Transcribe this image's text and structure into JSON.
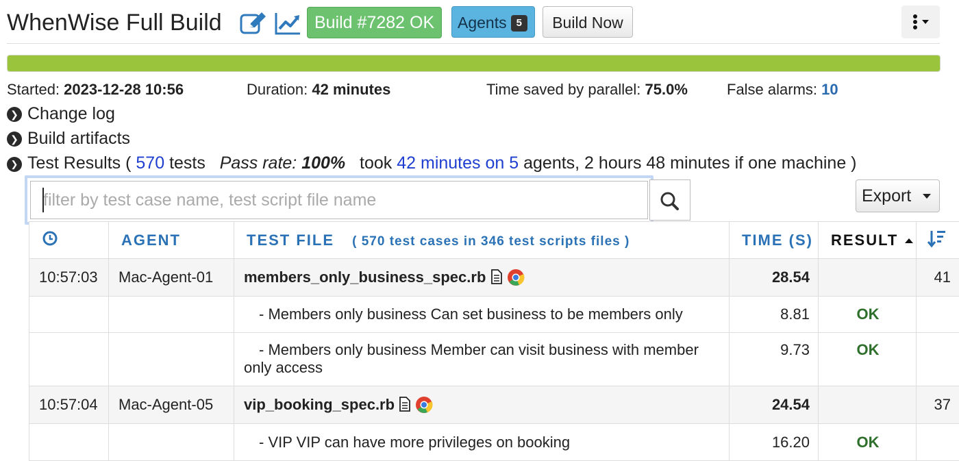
{
  "header": {
    "title": "WhenWise Full Build",
    "build_badge": "Build #7282 OK",
    "agents_label": "Agents",
    "agents_count": "5",
    "build_now": "Build Now",
    "menu_icon": "vertical-ellipsis-dropdown-icon"
  },
  "progress": {
    "fraction": 1.0,
    "color": "#9ac43b"
  },
  "stats": {
    "started_label": "Started:",
    "started_value": "2023-12-28 10:56",
    "duration_label": "Duration:",
    "duration_value": "42 minutes",
    "saved_label": "Time saved by parallel:",
    "saved_value": "75.0%",
    "false_alarms_label": "False alarms:",
    "false_alarms_value": "10"
  },
  "sections": {
    "change_log": "Change log",
    "build_artifacts": "Build artifacts",
    "test_results": {
      "label": "Test Results (",
      "tests_count": "570",
      "tests_word": "tests",
      "pass_label": "Pass rate:",
      "pass_value": "100%",
      "took": "took",
      "duration": "42 minutes",
      "on": "on",
      "agents": "5",
      "agents_tail": "agents, 2 hours 48 minutes if one machine )"
    }
  },
  "filter": {
    "placeholder": "filter by test case name, test script file name"
  },
  "export_label": "Export",
  "table": {
    "headers": {
      "agent": "AGENT",
      "test_file": "TEST FILE",
      "test_file_info": "( 570 test cases in 346 test scripts files )",
      "time": "TIME (S)",
      "result": "RESULT",
      "result_sort_icon": "sort-up-icon",
      "clock_icon": "clock-icon",
      "order_icon": "sort-amount-down-icon"
    },
    "rows": [
      {
        "kind": "file",
        "time": "10:57:03",
        "agent": "Mac-Agent-01",
        "file": "members_only_business_spec.rb",
        "duration": "28.54",
        "result": "",
        "order": "41"
      },
      {
        "kind": "case",
        "name": "- Members only business Can set business to be members only",
        "duration": "8.81",
        "result": "OK"
      },
      {
        "kind": "case",
        "name": "- Members only business Member can visit business with member only access",
        "duration": "9.73",
        "result": "OK"
      },
      {
        "kind": "file",
        "time": "10:57:04",
        "agent": "Mac-Agent-05",
        "file": "vip_booking_spec.rb",
        "duration": "24.54",
        "result": "",
        "order": "37"
      },
      {
        "kind": "case",
        "name": "- VIP VIP can have more privileges on booking",
        "duration": "16.20",
        "result": "OK"
      }
    ]
  }
}
